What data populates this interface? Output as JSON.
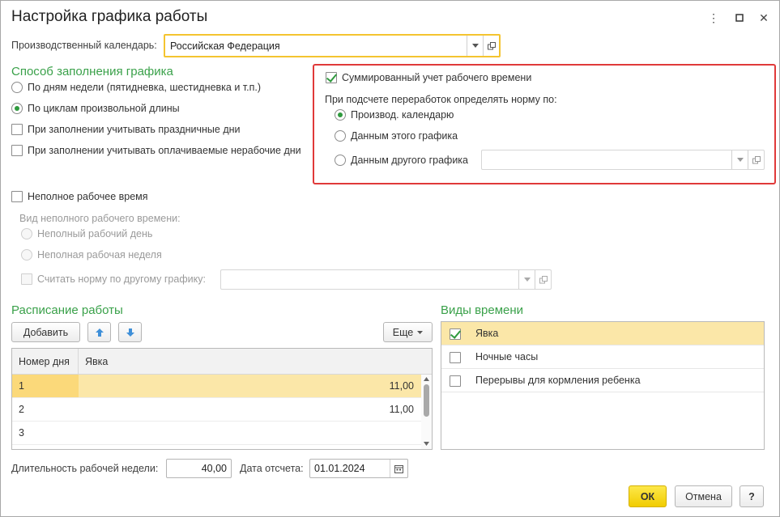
{
  "window": {
    "title": "Настройка графика работы"
  },
  "calendar": {
    "label": "Производственный календарь:",
    "value": "Российская Федерация"
  },
  "fill_method": {
    "title": "Способ заполнения графика",
    "options": [
      {
        "label": "По дням недели (пятидневка, шестидневка и т.п.)",
        "checked": false
      },
      {
        "label": "По циклам произвольной длины",
        "checked": true
      }
    ],
    "holidays_label": "При заполнении учитывать праздничные дни",
    "paid_nonworking_label": "При заполнении учитывать оплачиваемые нерабочие дни"
  },
  "summary": {
    "checkbox_label": "Суммированный учет рабочего времени",
    "norm_label": "При подсчете переработок определять норму по:",
    "options": [
      {
        "label": "Производ. календарю",
        "checked": true
      },
      {
        "label": "Данным этого графика",
        "checked": false
      },
      {
        "label": "Данным другого графика",
        "checked": false
      }
    ],
    "other_schedule_value": ""
  },
  "part_time": {
    "checkbox_label": "Неполное рабочее время",
    "kind_label": "Вид неполного рабочего времени:",
    "options": [
      {
        "label": "Неполный рабочий день"
      },
      {
        "label": "Неполная рабочая неделя"
      }
    ],
    "norm_other_label": "Считать норму по другому графику:",
    "norm_other_value": ""
  },
  "schedule": {
    "title": "Расписание работы",
    "add_label": "Добавить",
    "more_label": "Еще",
    "columns": [
      "Номер дня",
      "Явка"
    ],
    "rows": [
      {
        "day": "1",
        "value": "11,00"
      },
      {
        "day": "2",
        "value": "11,00"
      },
      {
        "day": "3",
        "value": ""
      }
    ]
  },
  "time_types": {
    "title": "Виды времени",
    "items": [
      {
        "label": "Явка",
        "checked": true
      },
      {
        "label": "Ночные часы",
        "checked": false
      },
      {
        "label": "Перерывы для кормления ребенка",
        "checked": false
      }
    ]
  },
  "footer": {
    "week_length_label": "Длительность рабочей недели:",
    "week_length_value": "40,00",
    "report_date_label": "Дата отсчета:",
    "report_date_value": "01.01.2024",
    "ok_label": "ОК",
    "cancel_label": "Отмена",
    "help_label": "?"
  }
}
